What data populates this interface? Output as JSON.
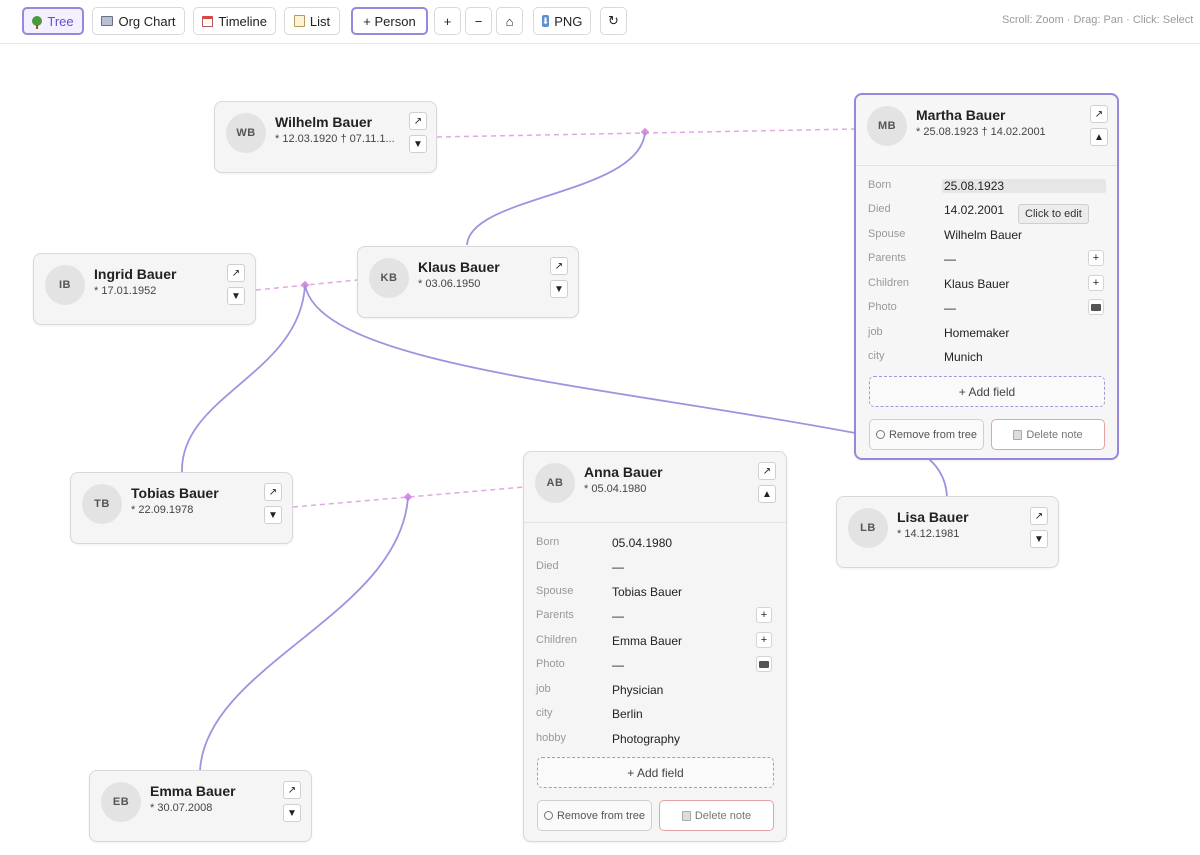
{
  "toolbar": {
    "tree": "Tree",
    "org_chart": "Org Chart",
    "timeline": "Timeline",
    "list": "List",
    "add_person": "+ Person",
    "zoom_in": "+",
    "zoom_out": "−",
    "home": "⌂",
    "png": "PNG",
    "reset": "↻",
    "hint": "Scroll: Zoom · Drag: Pan · Click: Select"
  },
  "colors": {
    "accent": "#9a86dc",
    "edge": "#a391e0",
    "spouse_link": "#e2a6e6"
  },
  "icons": {
    "open": "↗",
    "expand": "▼",
    "collapse": "▲",
    "plus": "+"
  },
  "people": {
    "wilhelm": {
      "initials": "WB",
      "name": "Wilhelm Bauer",
      "dates": "* 12.03.1920 † 07.11.1..."
    },
    "martha": {
      "initials": "MB",
      "name": "Martha Bauer",
      "dates": "* 25.08.1923 † 14.02.2001"
    },
    "ingrid": {
      "initials": "IB",
      "name": "Ingrid Bauer",
      "dates": "* 17.01.1952"
    },
    "klaus": {
      "initials": "KB",
      "name": "Klaus Bauer",
      "dates": "* 03.06.1950"
    },
    "tobias": {
      "initials": "TB",
      "name": "Tobias Bauer",
      "dates": "* 22.09.1978"
    },
    "anna": {
      "initials": "AB",
      "name": "Anna Bauer",
      "dates": "* 05.04.1980"
    },
    "lisa": {
      "initials": "LB",
      "name": "Lisa Bauer",
      "dates": "* 14.12.1981"
    },
    "emma": {
      "initials": "EB",
      "name": "Emma Bauer",
      "dates": "* 30.07.2008"
    }
  },
  "martha_details": [
    {
      "label": "Born",
      "value": "25.08.1923"
    },
    {
      "label": "Died",
      "value": "14.02.2001"
    },
    {
      "label": "Spouse",
      "value": "Wilhelm Bauer"
    },
    {
      "label": "Parents",
      "value": "—"
    },
    {
      "label": "Children",
      "value": "Klaus Bauer"
    },
    {
      "label": "Photo",
      "value": "—"
    },
    {
      "label": "job",
      "value": "Homemaker"
    },
    {
      "label": "city",
      "value": "Munich"
    }
  ],
  "anna_details": [
    {
      "label": "Born",
      "value": "05.04.1980"
    },
    {
      "label": "Died",
      "value": "—"
    },
    {
      "label": "Spouse",
      "value": "Tobias Bauer"
    },
    {
      "label": "Parents",
      "value": "—"
    },
    {
      "label": "Children",
      "value": "Emma Bauer"
    },
    {
      "label": "Photo",
      "value": "—"
    },
    {
      "label": "job",
      "value": "Physician"
    },
    {
      "label": "city",
      "value": "Berlin"
    },
    {
      "label": "hobby",
      "value": "Photography"
    }
  ],
  "tooltip": "Click to edit",
  "actions": {
    "add_field": "+ Add field",
    "remove_from_tree": "Remove from tree",
    "delete_note": "Delete note"
  }
}
